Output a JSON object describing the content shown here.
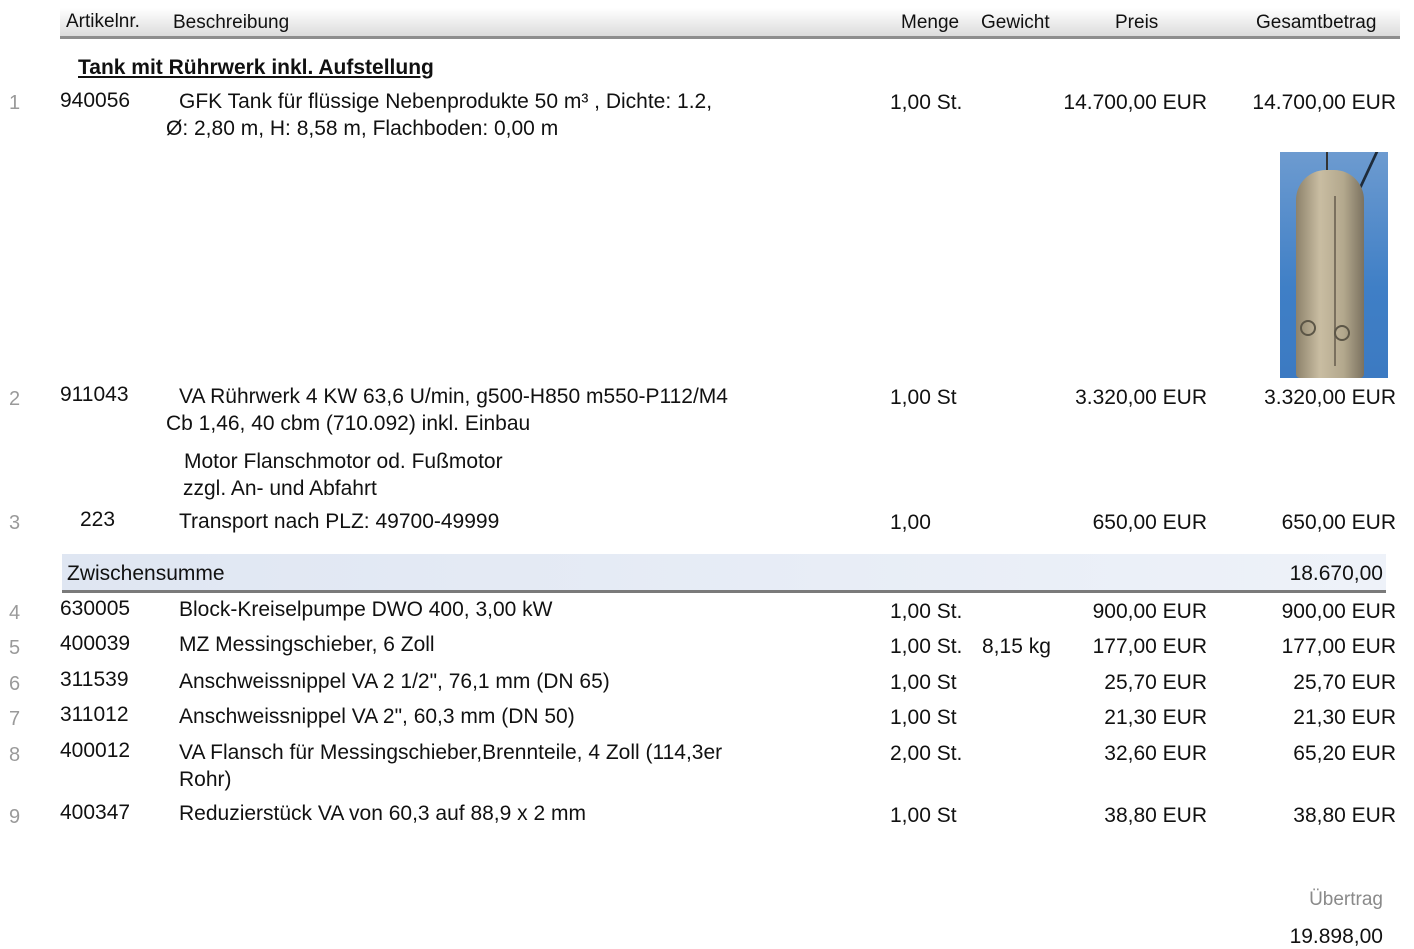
{
  "header": {
    "artikelnr": "Artikelnr.",
    "beschreibung": "Beschreibung",
    "menge": "Menge",
    "gewicht": "Gewicht",
    "preis": "Preis",
    "gesamtbetrag": "Gesamtbetrag"
  },
  "section_title": "Tank mit Rührwerk inkl. Aufstellung",
  "rows": [
    {
      "pos": "1",
      "artnr": "940056",
      "desc1": "GFK Tank für flüssige Nebenprodukte 50 m³ , Dichte: 1.2,",
      "desc2": "Ø: 2,80 m, H: 8,58 m, Flachboden: 0,00 m",
      "menge": "1,00 St.",
      "gewicht": "",
      "preis": "14.700,00 EUR",
      "gesamt": "14.700,00 EUR"
    },
    {
      "pos": "2",
      "artnr": "911043",
      "desc1": "VA Rührwerk 4 KW 63,6 U/min, g500-H850 m550-P112/M4",
      "desc2": "Cb 1,46, 40 cbm (710.092) inkl. Einbau",
      "menge": "1,00 St",
      "gewicht": "",
      "preis": "3.320,00 EUR",
      "gesamt": "3.320,00 EUR"
    },
    {
      "pos": "3",
      "artnr": "223",
      "desc1": "Transport nach PLZ: 49700-49999",
      "desc2": "",
      "menge": "1,00",
      "gewicht": "",
      "preis": "650,00 EUR",
      "gesamt": "650,00 EUR"
    },
    {
      "pos": "4",
      "artnr": "630005",
      "desc1": "Block-Kreiselpumpe DWO 400, 3,00 kW",
      "desc2": "",
      "menge": "1,00 St.",
      "gewicht": "",
      "preis": "900,00 EUR",
      "gesamt": "900,00 EUR"
    },
    {
      "pos": "5",
      "artnr": "400039",
      "desc1": "MZ Messingschieber, 6 Zoll",
      "desc2": "",
      "menge": "1,00 St.",
      "gewicht": "8,15 kg",
      "preis": "177,00 EUR",
      "gesamt": "177,00 EUR"
    },
    {
      "pos": "6",
      "artnr": "311539",
      "desc1": "Anschweissnippel VA 2 1/2\", 76,1 mm (DN 65)",
      "desc2": "",
      "menge": "1,00 St",
      "gewicht": "",
      "preis": "25,70 EUR",
      "gesamt": "25,70 EUR"
    },
    {
      "pos": "7",
      "artnr": "311012",
      "desc1": "Anschweissnippel VA 2\", 60,3 mm (DN 50)",
      "desc2": "",
      "menge": "1,00 St",
      "gewicht": "",
      "preis": "21,30 EUR",
      "gesamt": "21,30 EUR"
    },
    {
      "pos": "8",
      "artnr": "400012",
      "desc1": "VA Flansch für Messingschieber,Brennteile, 4 Zoll (114,3er",
      "desc2": "Rohr)",
      "menge": "2,00 St.",
      "gewicht": "",
      "preis": "32,60 EUR",
      "gesamt": "65,20 EUR"
    },
    {
      "pos": "9",
      "artnr": "400347",
      "desc1": "Reduzierstück VA von 60,3 auf 88,9 x 2 mm",
      "desc2": "",
      "menge": "1,00 St",
      "gewicht": "",
      "preis": "38,80 EUR",
      "gesamt": "38,80 EUR"
    }
  ],
  "notes": {
    "motor": "Motor Flanschmotor od. Fußmotor",
    "fahrt": "zzgl. An- und Abfahrt"
  },
  "subtotal": {
    "label": "Zwischensumme",
    "value": "18.670,00"
  },
  "carry": {
    "label": "Übertrag",
    "value": "19.898,00"
  }
}
